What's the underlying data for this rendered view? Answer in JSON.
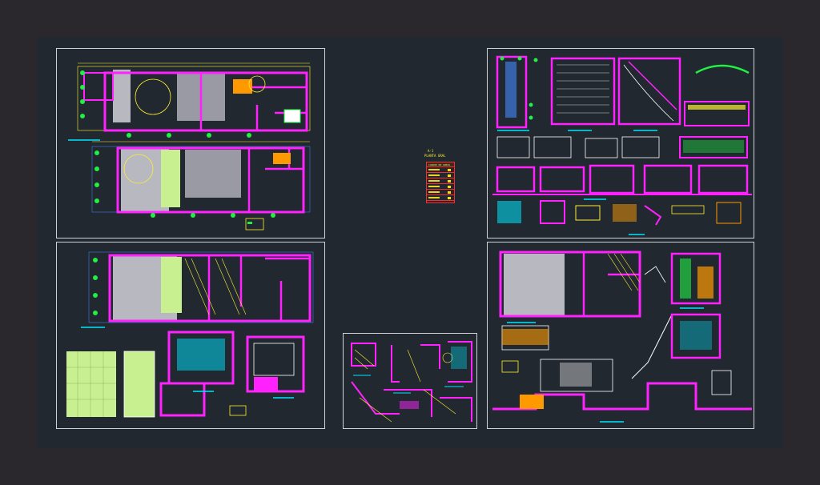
{
  "app": {
    "title": "",
    "colors": {
      "background": "#2a282c",
      "model_space": "#212830",
      "sheet_border": "#cfd3d8",
      "wall": "#ff22ff",
      "dimension": "#ffee33",
      "tree": "#22ee44",
      "grid": "#4488ff",
      "section_fill": "#b8b8c0",
      "lawn": "#c8f090",
      "annotation": "#00e5ff",
      "legend_border": "#ff2a2a"
    }
  },
  "sheets": [
    {
      "id": "plans-top",
      "content": "ground-floor-plans"
    },
    {
      "id": "plans-bottom",
      "content": "upper-floor-plan-and-details"
    },
    {
      "id": "sections-top",
      "content": "elevations-and-sections"
    },
    {
      "id": "sections-bottom",
      "content": "sections-and-stair-details"
    },
    {
      "id": "details-small",
      "content": "construction-details"
    }
  ],
  "legend": {
    "title": "A-1",
    "subtitle": "PLANTA GRAL",
    "header": "CUADRO DE AREAS",
    "rows": 6
  }
}
